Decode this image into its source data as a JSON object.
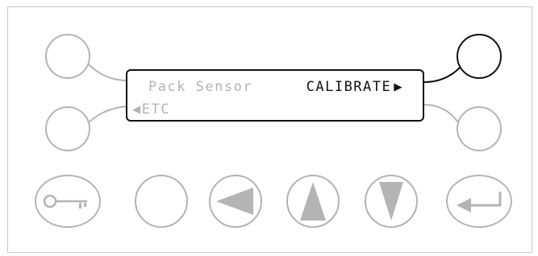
{
  "display": {
    "line1_left": "Pack Sensor",
    "line1_right": "CALIBRATE",
    "line2_left": "ETC"
  },
  "softkeys": {
    "top_left": "softkey-top-left",
    "bottom_left": "softkey-bottom-left",
    "top_right": "softkey-top-right (active)",
    "bottom_right": "softkey-bottom-right"
  },
  "buttons": {
    "row": [
      "key-icon",
      "blank",
      "arrow-left-icon",
      "arrow-up-icon",
      "arrow-down-icon",
      "enter-icon"
    ]
  },
  "colors": {
    "inactive": "#b4b4b4",
    "active": "#111111"
  }
}
